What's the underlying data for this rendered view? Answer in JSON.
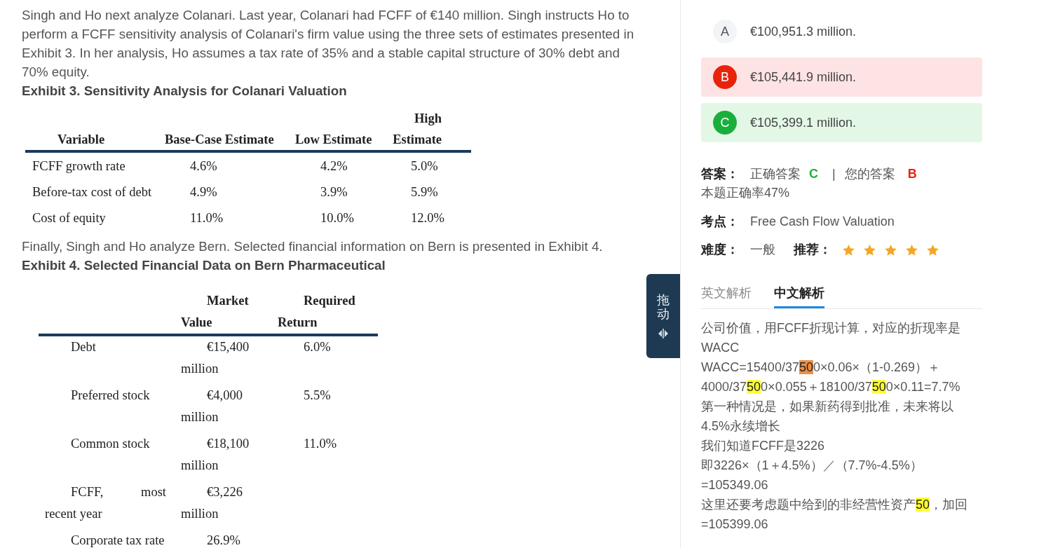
{
  "passage": {
    "intro": "Singh and Ho next analyze Colanari. Last year, Colanari had FCFF of €140 million. Singh instructs Ho to perform a FCFF sensitivity analysis of Colanari's firm value using the three sets of estimates presented in Exhibit 3. In her analysis, Ho assumes a tax rate of 35% and a stable capital structure of 30% debt and 70% equity.",
    "exhibit_3": {
      "title": "Exhibit 3. Sensitivity Analysis for Colanari Valuation",
      "columns": [
        "Variable",
        "Base-Case Estimate",
        "Low Estimate",
        "High Estimate"
      ],
      "rows": [
        [
          "FCFF growth rate",
          "4.6%",
          "4.2%",
          "5.0%"
        ],
        [
          "Before-tax cost of debt",
          "4.9%",
          "3.9%",
          "5.9%"
        ],
        [
          "Cost of equity",
          "11.0%",
          "10.0%",
          "12.0%"
        ]
      ]
    },
    "transition": "Finally, Singh and Ho analyze Bern. Selected financial information on Bern is presented in Exhibit 4.",
    "exhibit_4": {
      "title": "Exhibit 4. Selected Financial Data on Bern Pharmaceutical",
      "columns": [
        "",
        "Market Value",
        "Required Return"
      ],
      "rows": [
        [
          "Debt",
          "€15,400 million",
          "6.0%"
        ],
        [
          "Preferred stock",
          "€4,000 million",
          "5.5%"
        ],
        [
          "Common stock",
          "€18,100 million",
          "11.0%"
        ],
        [
          "FCFF, most recent year",
          "€3,226 million"
        ],
        [
          "Corporate tax rate",
          "26.9%"
        ]
      ]
    }
  },
  "drag_handle": {
    "label": "拖动"
  },
  "options": [
    {
      "letter": "A",
      "text": "€100,951.3 million.",
      "selected": false,
      "correct": false
    },
    {
      "letter": "B",
      "text": "€105,441.9 million.",
      "selected": true,
      "correct": false
    },
    {
      "letter": "C",
      "text": "€105,399.1 million.",
      "selected": false,
      "correct": true
    }
  ],
  "answer": {
    "label": "答案：",
    "correct_label": "正确答案",
    "correct": "C",
    "separator": "|",
    "yours_label": "您的答案",
    "yours": "B",
    "yours_correct": false,
    "rate": "本题正确率47%"
  },
  "topic": {
    "label": "考点：",
    "value": "Free Cash Flow Valuation"
  },
  "difficulty": {
    "label": "难度：",
    "value": "一般"
  },
  "recommendation": {
    "label": "推荐：",
    "stars": 5
  },
  "tabs": [
    {
      "label": "英文解析",
      "selected": false
    },
    {
      "label": "中文解析",
      "selected": true
    }
  ],
  "explanation": [
    {
      "segments": [
        {
          "text": "公司价值，用FCFF折现计算，对应的折现率是"
        }
      ]
    },
    {
      "segments": [
        {
          "text": "WACC"
        }
      ]
    },
    {
      "segments": [
        {
          "text": "WACC=15400/37"
        },
        {
          "text": "50",
          "color": "#ec8f45"
        },
        {
          "text": "0×0.06×（1-0.269）＋"
        }
      ]
    },
    {
      "segments": [
        {
          "text": "4000/37"
        },
        {
          "text": "50",
          "color": "#ffff33"
        },
        {
          "text": "0×0.055＋18100/37"
        },
        {
          "text": "50",
          "color": "#ffff33"
        },
        {
          "text": "0×0.11=7.7%"
        }
      ]
    },
    {
      "segments": [
        {
          "text": "第一种情况是，如果新药得到批准，未来将以"
        }
      ]
    },
    {
      "segments": [
        {
          "text": "4.5%永续增长"
        }
      ]
    },
    {
      "segments": [
        {
          "text": "我们知道FCFF是3226"
        }
      ]
    },
    {
      "segments": [
        {
          "text": "即3226×（1＋4.5%）／（7.7%-4.5%）"
        }
      ]
    },
    {
      "segments": [
        {
          "text": "=105349.06"
        }
      ]
    },
    {
      "segments": [
        {
          "text": "这里还要考虑题中给到的非经营性资产"
        },
        {
          "text": "50",
          "color": "#ffff33"
        },
        {
          "text": "，加回"
        }
      ]
    },
    {
      "segments": [
        {
          "text": "=105399.06"
        }
      ]
    }
  ]
}
